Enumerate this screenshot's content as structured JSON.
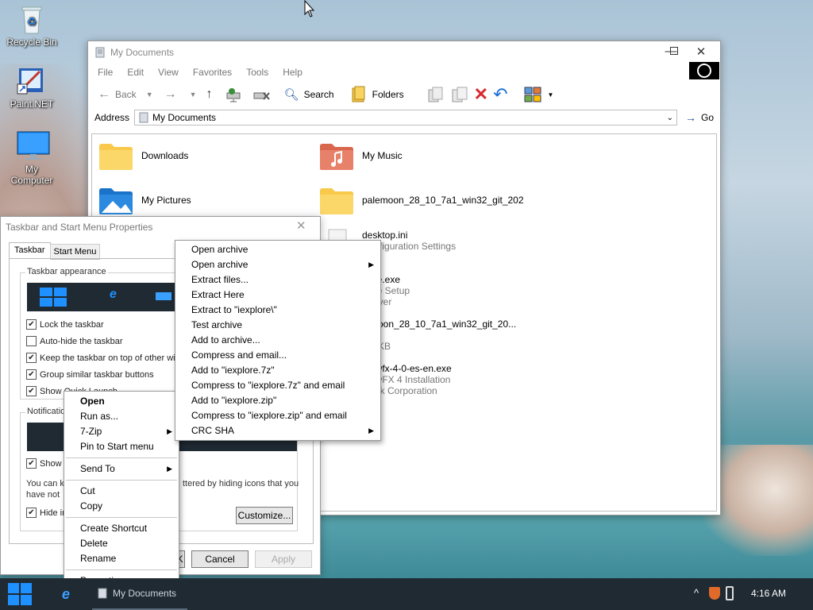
{
  "desktop": {
    "icons": [
      {
        "label": "Recycle Bin"
      },
      {
        "label": "Paint.NET"
      },
      {
        "label": "My\nComputer"
      }
    ]
  },
  "explorer": {
    "title": "My Documents",
    "menu": [
      "File",
      "Edit",
      "View",
      "Favorites",
      "Tools",
      "Help"
    ],
    "toolbar": {
      "back": "Back",
      "search": "Search",
      "folders": "Folders"
    },
    "address_label": "Address",
    "address_value": "My Documents",
    "go": "Go",
    "files": [
      {
        "name": "Downloads"
      },
      {
        "name": "My Music"
      },
      {
        "name": "My Pictures"
      },
      {
        "name": "palemoon_28_10_7a1_win32_git_202"
      },
      {
        "name": "desktop.ini",
        "sub": "Configuration Settings"
      },
      {
        "name": "...life.exe",
        "sub1": "...life Setup",
        "sub2": "...erver"
      },
      {
        "name": "...moon_28_10_7a1_win32_git_20...",
        "sub1": "...e",
        "sub2": "...2 KB"
      },
      {
        "name": "...owfx-4-0-es-en.exe",
        "sub1": "...owFX 4 Installation",
        "sub2": "...ock Corporation"
      }
    ]
  },
  "taskbar_props": {
    "title": "Taskbar and Start Menu Properties",
    "tabs": [
      "Taskbar",
      "Start Menu"
    ],
    "appearance_title": "Taskbar appearance",
    "checks": [
      {
        "label": "Lock the taskbar",
        "checked": true
      },
      {
        "label": "Auto-hide the taskbar",
        "checked": false
      },
      {
        "label": "Keep the taskbar on top of other win",
        "checked": true
      },
      {
        "label": "Group similar taskbar buttons",
        "checked": true
      },
      {
        "label": "Show Quick Launch",
        "checked": true
      }
    ],
    "notification_title": "Notificatio",
    "show_clock": "Show",
    "info_text_1": "You can k",
    "info_text_1b": "ttered by hiding icons that you",
    "info_text_2": "have not",
    "hide_inactive": "Hide in",
    "customize": "Customize...",
    "ok": "OK",
    "cancel": "Cancel",
    "apply": "Apply"
  },
  "context_menu": {
    "items": [
      "Open",
      "Run as...",
      "7-Zip",
      "Pin to Start menu"
    ],
    "send_to": "Send To",
    "edit": [
      "Cut",
      "Copy"
    ],
    "manage": [
      "Create Shortcut",
      "Delete",
      "Rename"
    ],
    "properties": "Properties"
  },
  "zip_menu": {
    "items": [
      {
        "label": "Open archive",
        "sub": false
      },
      {
        "label": "Open archive",
        "sub": true
      },
      {
        "label": "Extract files...",
        "sub": false
      },
      {
        "label": "Extract Here",
        "sub": false
      },
      {
        "label": "Extract to \"iexplore\\\"",
        "sub": false
      },
      {
        "label": "Test archive",
        "sub": false
      },
      {
        "label": "Add to archive...",
        "sub": false
      },
      {
        "label": "Compress and email...",
        "sub": false
      },
      {
        "label": "Add to \"iexplore.7z\"",
        "sub": false
      },
      {
        "label": "Compress to \"iexplore.7z\" and email",
        "sub": false
      },
      {
        "label": "Add to \"iexplore.zip\"",
        "sub": false
      },
      {
        "label": "Compress to \"iexplore.zip\" and email",
        "sub": false
      },
      {
        "label": "CRC SHA",
        "sub": true
      }
    ]
  },
  "taskbar": {
    "task_label": "My Documents",
    "clock": "4:16 AM"
  },
  "colors": {
    "accent": "#0078d7",
    "taskbar": "#1f2a33",
    "folder": "#f8c94a",
    "close_red": "#d9282f"
  }
}
